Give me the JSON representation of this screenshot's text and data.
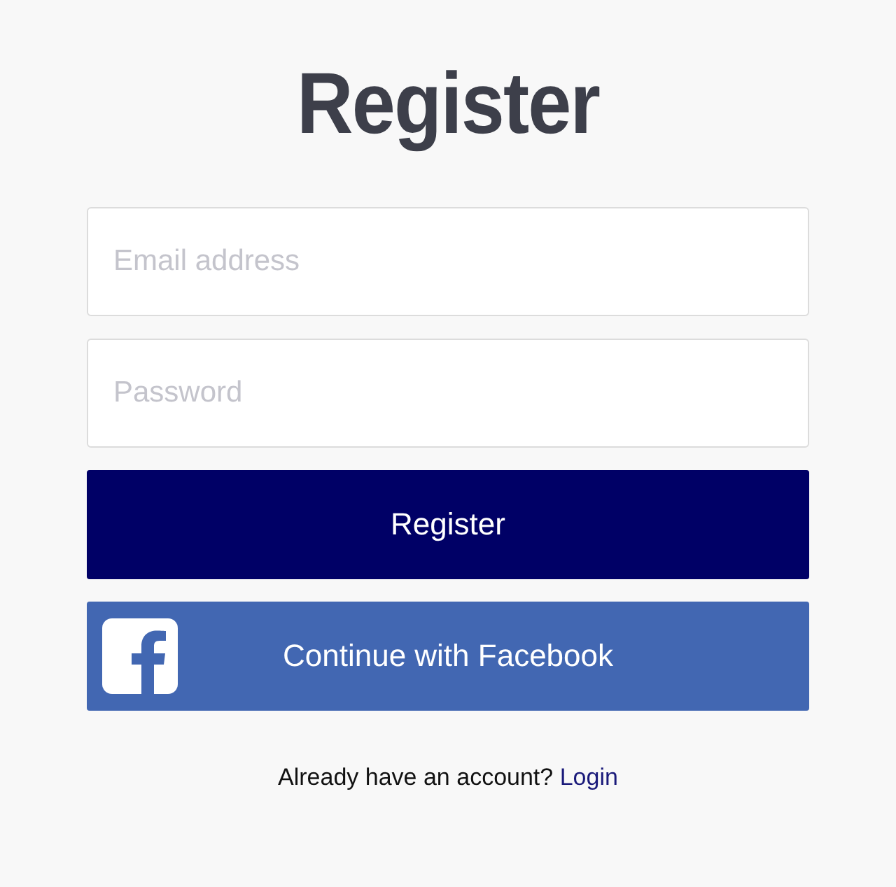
{
  "title": "Register",
  "fields": [
    {
      "placeholder": "Email address"
    },
    {
      "placeholder": "Password"
    }
  ],
  "buttons": [
    {
      "label": "Register",
      "kind": "primary"
    },
    {
      "label": "Continue with Facebook",
      "kind": "facebook"
    }
  ],
  "footer": {
    "text": "Already have an account?",
    "link": "Login"
  }
}
